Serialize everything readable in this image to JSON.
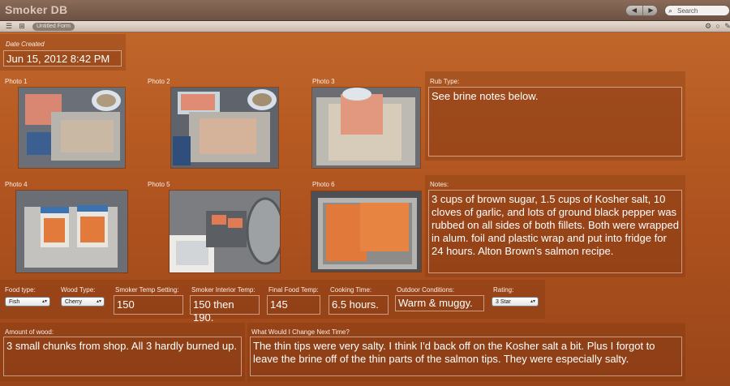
{
  "window": {
    "title": "Smoker DB"
  },
  "search": {
    "placeholder": "Search"
  },
  "toolbar": {
    "form_name": "Untitled Form"
  },
  "date_created": {
    "label": "Date Created",
    "value": "Jun 15, 2012 8:42 PM"
  },
  "photos": {
    "labels": [
      "Photo 1",
      "Photo 2",
      "Photo 3",
      "Photo 4",
      "Photo 5",
      "Photo 6"
    ]
  },
  "rub_type": {
    "label": "Rub Type:",
    "value": "See brine notes below."
  },
  "notes": {
    "label": "Notes:",
    "value": "3 cups of brown sugar, 1.5 cups of Kosher salt, 10 cloves of garlic, and lots of ground black pepper was rubbed on all sides of both fillets. Both were wrapped in alum. foil and plastic wrap and put into fridge for 24 hours. Alton Brown's salmon recipe."
  },
  "food_type": {
    "label": "Food type:",
    "value": "Fish"
  },
  "wood_type": {
    "label": "Wood Type:",
    "value": "Cherry"
  },
  "smoker_temp_setting": {
    "label": "Smoker Temp Setting:",
    "value": "150"
  },
  "smoker_interior_temp": {
    "label": "Smoker Interior Temp:",
    "value": "150 then 190."
  },
  "final_food_temp": {
    "label": "Final Food Temp:",
    "value": "145"
  },
  "cooking_time": {
    "label": "Cooking Time:",
    "value": "6.5 hours."
  },
  "outdoor_conditions": {
    "label": "Outdoor Conditions:",
    "value": "Warm & muggy."
  },
  "rating": {
    "label": "Rating:",
    "value": "3 Star"
  },
  "amount_of_wood": {
    "label": "Amount of wood:",
    "value": "3 small chunks from shop. All 3 hardly burned up."
  },
  "change_next_time": {
    "label": "What Would I Change Next Time?",
    "value": "The thin tips were very salty. I think I'd back off on the Kosher salt a bit. Plus I forgot to leave the brine off of the thin parts of the salmon tips. They were especially salty."
  }
}
